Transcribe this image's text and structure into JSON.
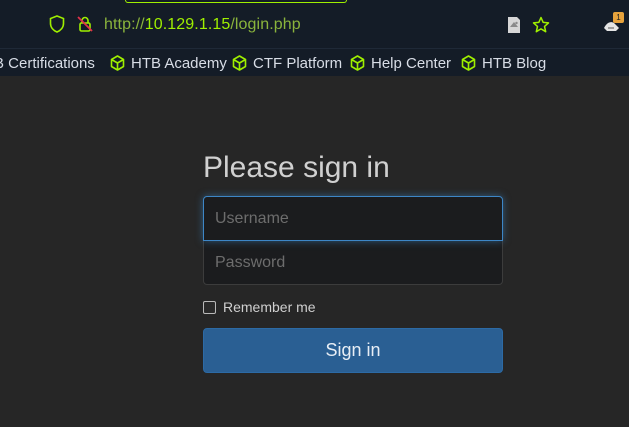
{
  "url_bar": {
    "url_prefix": "http://",
    "url_host": "10.129.1.15",
    "url_path": "/login.php",
    "notification_count": "1"
  },
  "bookmarks": [
    {
      "label": "B Certifications"
    },
    {
      "label": "HTB Academy"
    },
    {
      "label": "CTF Platform"
    },
    {
      "label": "Help Center"
    },
    {
      "label": "HTB Blog"
    }
  ],
  "login": {
    "title": "Please sign in",
    "username_placeholder": "Username",
    "password_placeholder": "Password",
    "remember_label": "Remember me",
    "submit_label": "Sign in"
  },
  "colors": {
    "accent_green": "#9fef00",
    "button_blue": "#2a5f93",
    "focus_blue": "#3d86c6"
  }
}
